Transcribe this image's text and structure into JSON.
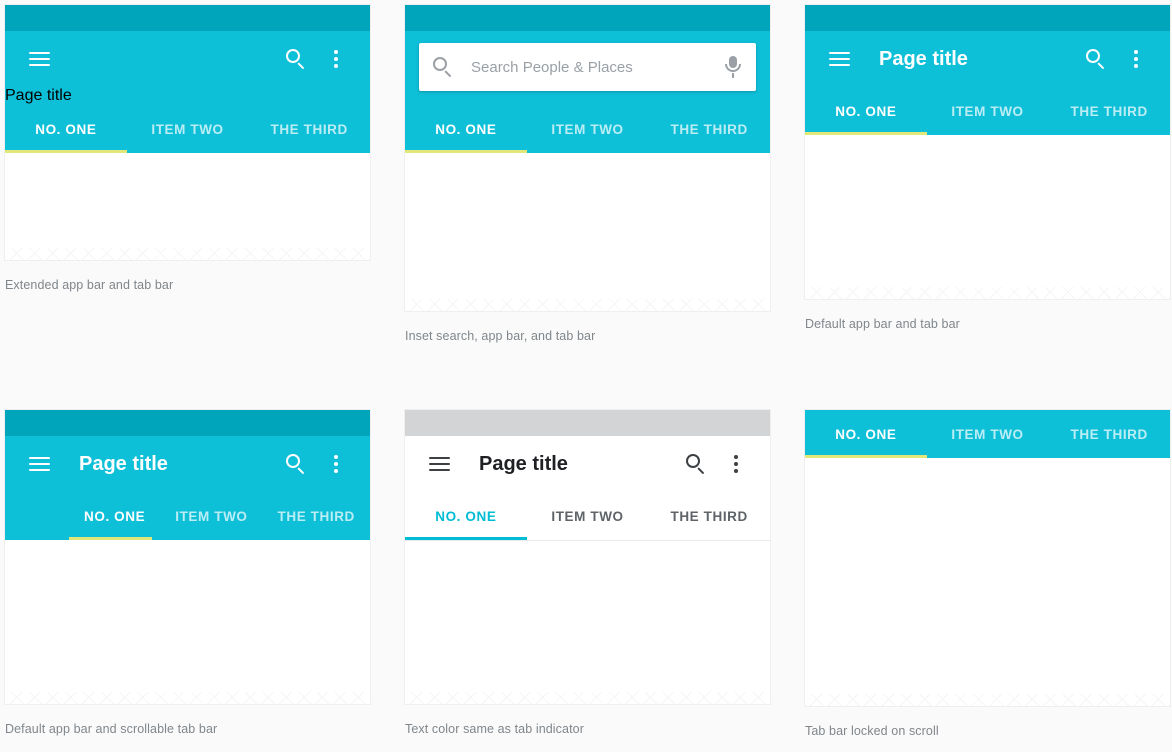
{
  "page": {
    "background_color": "#fafafa",
    "accent_cyan": "#0ebfd8",
    "statusbar_cyan": "#00a5bb",
    "indicator_yellow": "#e2e77a",
    "indicator_teal": "#00bcd4",
    "statusbar_grey": "#d2d4d6"
  },
  "common": {
    "page_title": "Page title",
    "tabs": [
      "NO. ONE",
      "ITEM TWO",
      "THE THIRD"
    ],
    "icons": {
      "menu": "hamburger-icon",
      "search": "search-icon",
      "overflow": "overflow-menu-icon",
      "mic": "microphone-icon"
    }
  },
  "panels": [
    {
      "id": "extended-app-bar",
      "caption": "Extended app bar and tab bar",
      "title": "Page title",
      "tabs": [
        {
          "label": "NO. ONE",
          "active": true
        },
        {
          "label": "ITEM TWO",
          "active": false
        },
        {
          "label": "THE THIRD",
          "active": false
        }
      ]
    },
    {
      "id": "inset-search",
      "caption": "Inset search, app bar, and tab bar",
      "search_placeholder": "Search People  & Places",
      "tabs": [
        {
          "label": "NO. ONE",
          "active": true
        },
        {
          "label": "ITEM TWO",
          "active": false
        },
        {
          "label": "THE THIRD",
          "active": false
        }
      ]
    },
    {
      "id": "default-app-bar",
      "caption": "Default app bar and tab bar",
      "title": "Page title",
      "tabs": [
        {
          "label": "NO. ONE",
          "active": true
        },
        {
          "label": "ITEM TWO",
          "active": false
        },
        {
          "label": "THE THIRD",
          "active": false
        }
      ]
    },
    {
      "id": "scrollable-tab-bar",
      "caption": "Default app bar and scrollable tab bar",
      "title": "Page title",
      "tabs": [
        {
          "label": "NO. ONE",
          "active": true
        },
        {
          "label": "ITEM TWO",
          "active": false
        },
        {
          "label": "THE THIRD",
          "active": false
        }
      ]
    },
    {
      "id": "text-color-same-as-indicator",
      "caption": "Text color same as tab indicator",
      "title": "Page title",
      "tabs": [
        {
          "label": "NO. ONE",
          "active": true
        },
        {
          "label": "ITEM TWO",
          "active": false
        },
        {
          "label": "THE THIRD",
          "active": false
        }
      ]
    },
    {
      "id": "tab-bar-locked-on-scroll",
      "caption": "Tab bar locked on scroll",
      "tabs": [
        {
          "label": "NO. ONE",
          "active": true
        },
        {
          "label": "ITEM TWO",
          "active": false
        },
        {
          "label": "THE THIRD",
          "active": false
        }
      ]
    }
  ]
}
